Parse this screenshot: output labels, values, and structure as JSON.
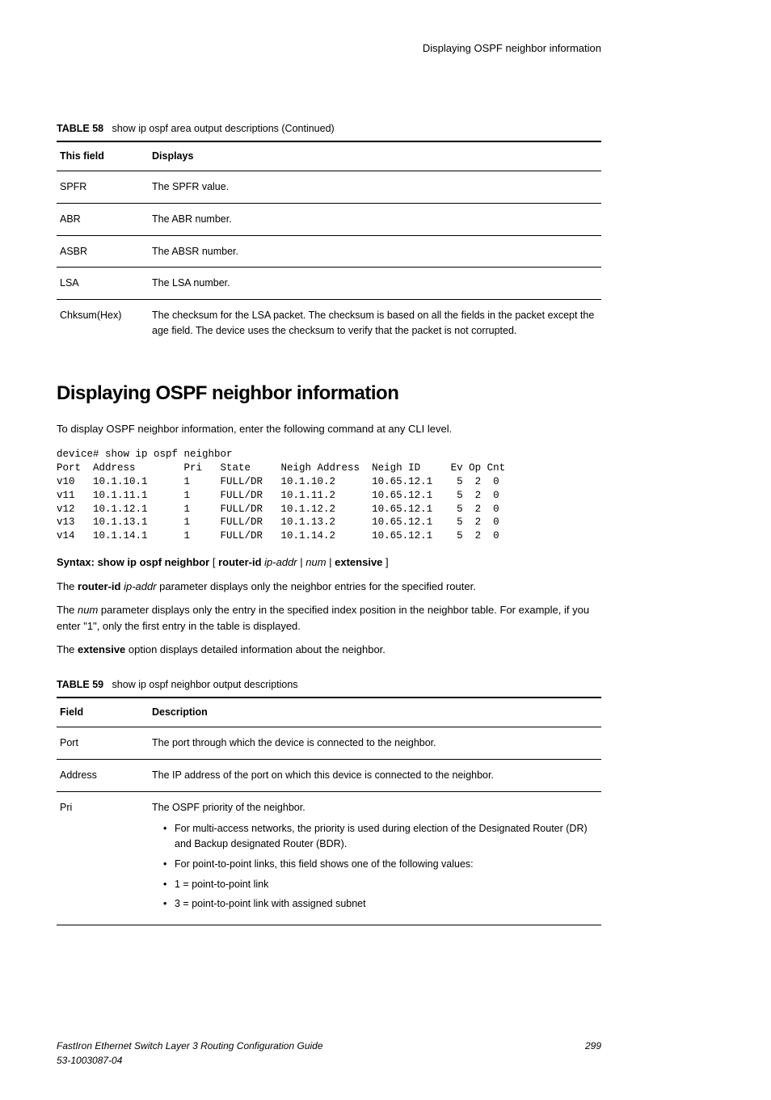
{
  "header_right": "Displaying OSPF neighbor information",
  "table58": {
    "caption_label": "TABLE 58",
    "caption_text": "show ip ospf area output descriptions (Continued)",
    "head_field": "This field",
    "head_displays": "Displays",
    "rows": [
      {
        "field": "SPFR",
        "desc": "The SPFR value."
      },
      {
        "field": "ABR",
        "desc": "The ABR number."
      },
      {
        "field": "ASBR",
        "desc": "The ABSR number."
      },
      {
        "field": "LSA",
        "desc": "The LSA number."
      },
      {
        "field": "Chksum(Hex)",
        "desc": "The checksum for the LSA packet. The checksum is based on all the fields in the packet except the age field. The device uses the checksum to verify that the packet is not corrupted."
      }
    ]
  },
  "section_heading": "Displaying OSPF neighbor information",
  "intro_para": "To display OSPF neighbor information, enter the following command at any CLI level.",
  "cli_output": "device# show ip ospf neighbor\nPort  Address        Pri   State     Neigh Address  Neigh ID     Ev Op Cnt\nv10   10.1.10.1      1     FULL/DR   10.1.10.2      10.65.12.1    5  2  0\nv11   10.1.11.1      1     FULL/DR   10.1.11.2      10.65.12.1    5  2  0\nv12   10.1.12.1      1     FULL/DR   10.1.12.2      10.65.12.1    5  2  0\nv13   10.1.13.1      1     FULL/DR   10.1.13.2      10.65.12.1    5  2  0\nv14   10.1.14.1      1     FULL/DR   10.1.14.2      10.65.12.1    5  2  0",
  "syntax": {
    "label": "Syntax: ",
    "cmd": "show ip ospf neighbor",
    "opt1": " [ ",
    "router_id": "router-id",
    "ipaddr": " ip-addr",
    "sep1": " | ",
    "num": "num",
    "sep2": " | ",
    "extensive": "extensive",
    "close": " ]"
  },
  "para_router_id_pre": "The ",
  "para_router_id_bold": "router-id",
  "para_router_id_em": " ip-addr",
  "para_router_id_post": " parameter displays only the neighbor entries for the specified router.",
  "para_num_pre": "The ",
  "para_num_em": "num",
  "para_num_post": " parameter displays only the entry in the specified index position in the neighbor table. For example, if you enter \"1\", only the first entry in the table is displayed.",
  "para_ext_pre": "The ",
  "para_ext_bold": "extensive",
  "para_ext_post": " option displays detailed information about the neighbor.",
  "table59": {
    "caption_label": "TABLE 59",
    "caption_text": "show ip ospf neighbor output descriptions",
    "head_field": "Field",
    "head_desc": "Description",
    "rows": [
      {
        "field": "Port",
        "desc": "The port through which the device is connected to the neighbor."
      },
      {
        "field": "Address",
        "desc": "The IP address of the port on which this device is connected to the neighbor."
      }
    ],
    "pri_field": "Pri",
    "pri_intro": "The OSPF priority of the neighbor.",
    "pri_items": [
      "For multi-access networks, the priority is used during election of the Designated Router (DR) and Backup designated Router (BDR).",
      "For point-to-point links, this field shows one of the following values:",
      "1 = point-to-point link",
      "3 = point-to-point link with assigned subnet"
    ]
  },
  "footer": {
    "left1": "FastIron Ethernet Switch Layer 3 Routing Configuration Guide",
    "left2": "53-1003087-04",
    "right": "299"
  }
}
